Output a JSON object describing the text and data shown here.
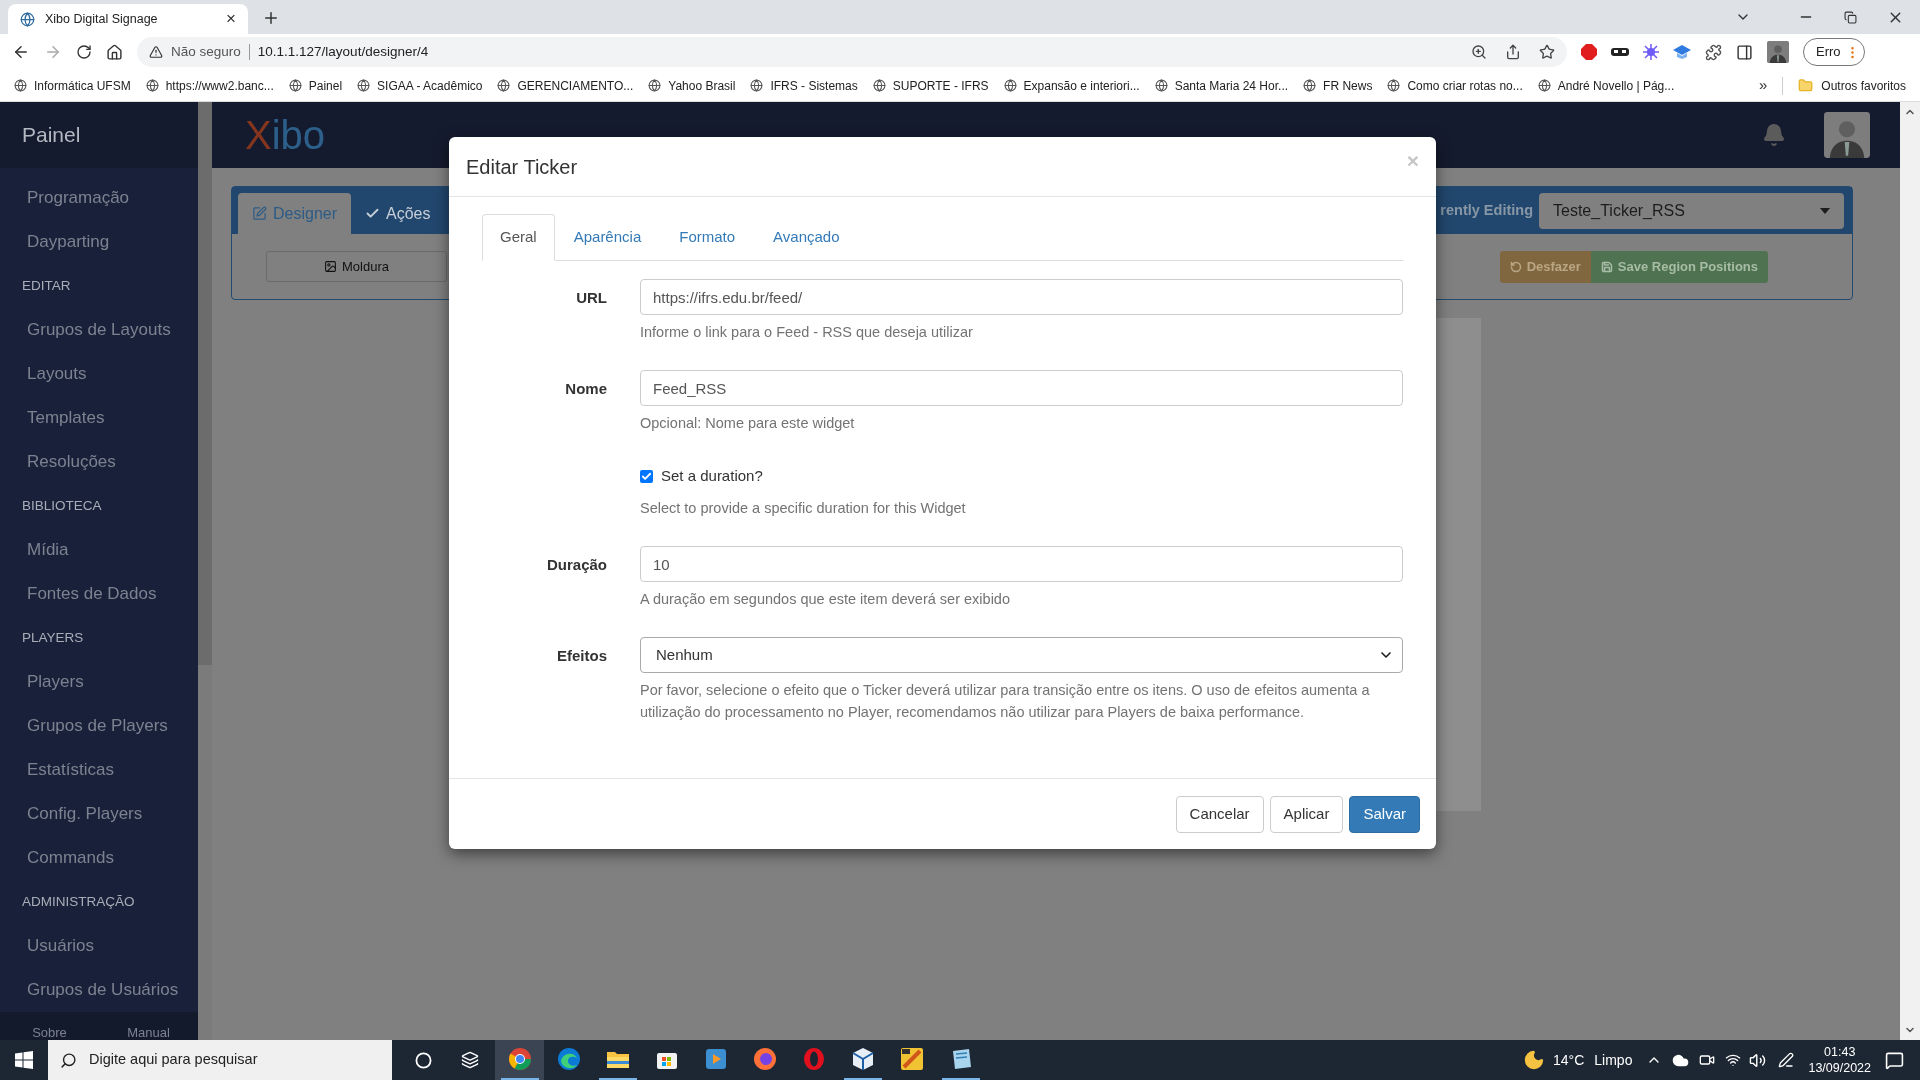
{
  "browser": {
    "tab_title": "Xibo Digital Signage",
    "tab_close": "×",
    "security": "Não seguro",
    "url": "10.1.1.127/layout/designer/4",
    "profile_button": "Erro",
    "bookmarks": [
      "Informática UFSM",
      "https://www2.banc...",
      "Painel",
      "SIGAA - Acadêmico",
      "GERENCIAMENTO...",
      "Yahoo Brasil",
      "IFRS - Sistemas",
      "SUPORTE - IFRS",
      "Expansão e interiori...",
      "Santa Maria 24 Hor...",
      "FR News",
      "Como criar rotas no...",
      "André Novello | Pág..."
    ],
    "more_bookmarks": "»",
    "other_bookmarks": "Outros favoritos"
  },
  "sidebar": {
    "title": "Painel",
    "entries": [
      {
        "kind": "link",
        "label": "Programação"
      },
      {
        "kind": "link",
        "label": "Dayparting"
      },
      {
        "kind": "heading",
        "label": "EDITAR"
      },
      {
        "kind": "link",
        "label": "Grupos de Layouts"
      },
      {
        "kind": "link",
        "label": "Layouts"
      },
      {
        "kind": "link",
        "label": "Templates"
      },
      {
        "kind": "link",
        "label": "Resoluções"
      },
      {
        "kind": "heading",
        "label": "BIBLIOTECA"
      },
      {
        "kind": "link",
        "label": "Mídia"
      },
      {
        "kind": "link",
        "label": "Fontes de Dados"
      },
      {
        "kind": "heading",
        "label": "PLAYERS"
      },
      {
        "kind": "link",
        "label": "Players"
      },
      {
        "kind": "link",
        "label": "Grupos de Players"
      },
      {
        "kind": "link",
        "label": "Estatísticas"
      },
      {
        "kind": "link",
        "label": "Config. Players"
      },
      {
        "kind": "link",
        "label": "Commands"
      },
      {
        "kind": "heading",
        "label": "ADMINISTRAÇÃO"
      },
      {
        "kind": "link",
        "label": "Usuários"
      },
      {
        "kind": "link",
        "label": "Grupos de Usuários"
      }
    ],
    "footer": [
      "Sobre",
      "Manual"
    ]
  },
  "header": {
    "logo": "Xibo"
  },
  "designer": {
    "tabs": [
      {
        "label": "Designer",
        "selected": true
      },
      {
        "label": "Ações",
        "selected": false
      }
    ],
    "editing_label": "rently Editing",
    "layout_select": "Teste_Ticker_RSS",
    "buttons": [
      {
        "kind": "default",
        "label": "Moldura"
      },
      {
        "kind": "warning",
        "label": "Desfazer"
      },
      {
        "kind": "success",
        "label": "Save Region Positions"
      }
    ]
  },
  "modal": {
    "title": "Editar Ticker",
    "close": "×",
    "tabs": [
      {
        "label": "Geral",
        "selected": true
      },
      {
        "label": "Aparência",
        "selected": false
      },
      {
        "label": "Formato",
        "selected": false
      },
      {
        "label": "Avançado",
        "selected": false
      }
    ],
    "fields": [
      {
        "kind": "text",
        "label": "URL",
        "value": "https://ifrs.edu.br/feed/",
        "help": "Informe o link para o Feed - RSS que deseja utilizar"
      },
      {
        "kind": "text",
        "label": "Nome",
        "value": "Feed_RSS",
        "help": "Opcional: Nome para este widget"
      },
      {
        "kind": "checkbox",
        "text": "Set a duration?",
        "checked": true,
        "help": "Select to provide a specific duration for this Widget"
      },
      {
        "kind": "text",
        "label": "Duração",
        "value": "10",
        "help": "A duração em segundos que este item deverá ser exibido"
      },
      {
        "kind": "select",
        "label": "Efeitos",
        "value": "Nenhum",
        "help": "Por favor, selecione o efeito que o Ticker deverá utilizar para transição entre os itens. O uso de efeitos aumenta a utilização do processamento no Player, recomendamos não utilizar para Players de baixa performance."
      }
    ],
    "buttons": [
      {
        "kind": "default",
        "label": "Cancelar"
      },
      {
        "kind": "default",
        "label": "Aplicar"
      },
      {
        "kind": "primary",
        "label": "Salvar"
      }
    ]
  },
  "taskbar": {
    "search_placeholder": "Digite aqui para pesquisar",
    "apps": [
      {
        "selected": true,
        "open": true
      },
      {
        "selected": false,
        "open": false
      },
      {
        "selected": false,
        "open": true
      },
      {
        "selected": false,
        "open": false
      },
      {
        "selected": false,
        "open": false
      },
      {
        "selected": false,
        "open": false
      },
      {
        "selected": false,
        "open": false
      },
      {
        "selected": false,
        "open": true
      },
      {
        "selected": false,
        "open": false
      },
      {
        "selected": false,
        "open": true
      }
    ],
    "temperature": "14°C",
    "weather": "Limpo",
    "time": "01:43",
    "date": "13/09/2022"
  }
}
